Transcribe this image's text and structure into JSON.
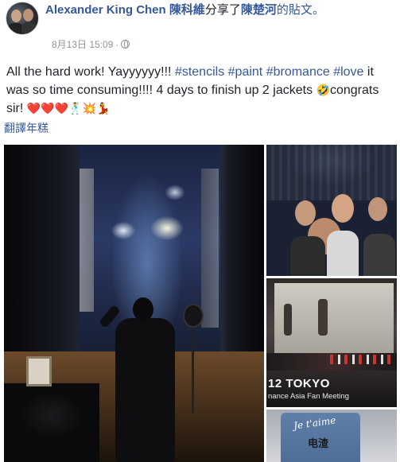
{
  "post": {
    "author": "Alexander King Chen",
    "shared_prefix": "分享了",
    "shared_name": "陳楚河",
    "shared_suffix": "的貼文。",
    "author_chinese": "陳科維",
    "timestamp": "8月13日 15:09",
    "separator": "·",
    "privacy_icon": "globe-icon",
    "text_before": "All the hard work! Yayyyyyy!!! ",
    "hashtags": [
      "#stencils",
      "#paint",
      "#bromance",
      "#love"
    ],
    "text_after": " it was so time consuming!!!! 4 days to finish up 2 jackets ",
    "laugh_emoji": "🤣",
    "text_end": "congrats sir! ",
    "trailing_emojis": "❤️❤️❤️🕺💥💃",
    "translate_label": "翻譯年糕"
  },
  "photos": {
    "tokyo_label": "12 TOKYO",
    "fan_meeting_label": "nance Asia Fan Meeting",
    "jacket_text": "Je t'aime",
    "jacket_chinese": "电渣"
  },
  "colors": {
    "link": "#365899",
    "text": "#1d2129",
    "meta": "#90949c"
  }
}
